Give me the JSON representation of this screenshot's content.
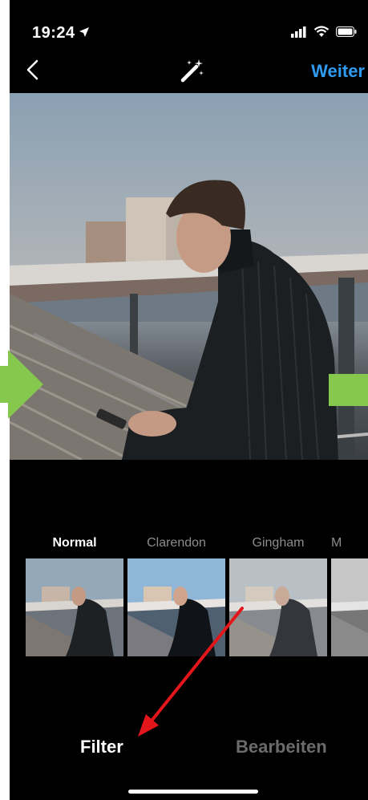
{
  "status_bar": {
    "time": "19:24",
    "icons": [
      "location-arrow-icon",
      "signal-icon",
      "wifi-icon",
      "battery-icon"
    ]
  },
  "header": {
    "next_label": "Weiter",
    "icons": [
      "back-chevron-icon",
      "magic-wand-icon"
    ]
  },
  "filters": [
    {
      "label": "Normal",
      "active": true
    },
    {
      "label": "Clarendon",
      "active": false
    },
    {
      "label": "Gingham",
      "active": false
    },
    {
      "label": "M",
      "active": false
    }
  ],
  "tabs": {
    "filter": "Filter",
    "edit": "Bearbeiten"
  },
  "colors": {
    "accent": "#2e9bf0",
    "green_arrow": "#86c84e",
    "red_arrow": "#e3161b"
  }
}
